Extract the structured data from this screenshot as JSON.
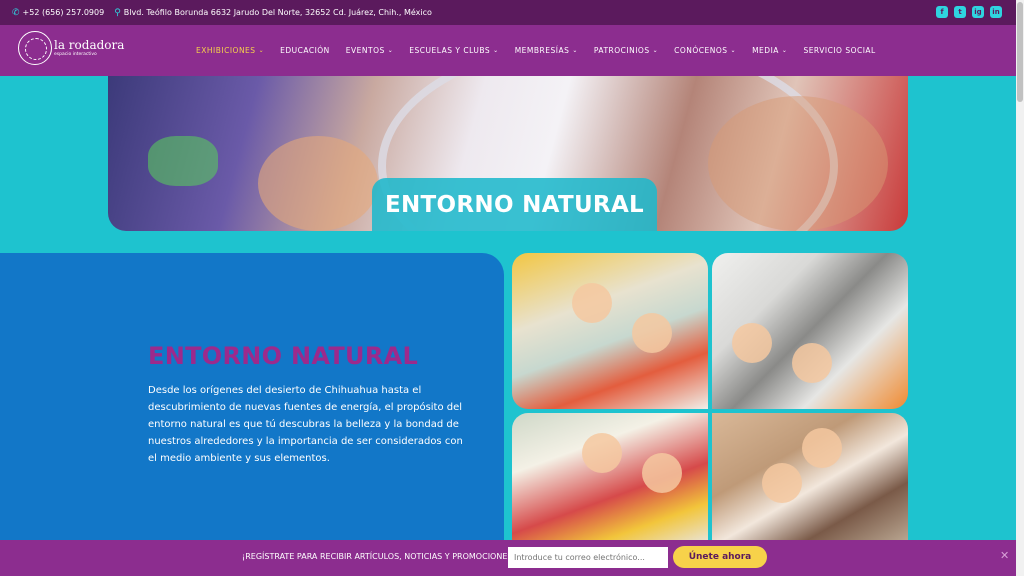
{
  "topbar": {
    "phone": "+52 (656) 257.0909",
    "address": "Blvd. Teófilo Borunda 6632 Jarudo Del Norte, 32652 Cd. Juárez, Chih., México",
    "social": [
      "f",
      "t",
      "ig",
      "in"
    ]
  },
  "logo": {
    "line1": "la rodadora",
    "line2": "espacio interactivo"
  },
  "nav": {
    "items": [
      {
        "label": "EXHIBICIONES",
        "dropdown": true
      },
      {
        "label": "EDUCACIÓN",
        "dropdown": false
      },
      {
        "label": "EVENTOS",
        "dropdown": true
      },
      {
        "label": "ESCUELAS Y CLUBS",
        "dropdown": true
      },
      {
        "label": "MEMBRESÍAS",
        "dropdown": true
      },
      {
        "label": "PATROCINIOS",
        "dropdown": true
      },
      {
        "label": "CONÓCENOS",
        "dropdown": true
      },
      {
        "label": "MEDIA",
        "dropdown": true
      },
      {
        "label": "SERVICIO SOCIAL",
        "dropdown": false
      }
    ],
    "active": "EXHIBICIONES"
  },
  "hero": {
    "title": "ENTORNO NATURAL"
  },
  "section": {
    "title": "ENTORNO NATURAL",
    "text": "Desde los orígenes del desierto de Chihuahua hasta el descubrimiento de nuevas fuentes de energía, el propósito del entorno natural es que tú descubras la belleza y la bondad de nuestros alrededores y la importancia de ser considerados con el medio ambiente y sus elementos."
  },
  "subscribe": {
    "text": "¡REGÍSTRATE PARA RECIBIR ARTÍCULOS, NOTICIAS Y PROMOCIONES!",
    "placeholder": "Introduce tu correo electrónico...",
    "button": "Únete ahora",
    "close": "✕"
  },
  "colors": {
    "topbar": "#5b1a5d",
    "nav": "#8c2d8f",
    "teal": "#1ec3cf",
    "blue": "#1277c8",
    "title": "#9c2a8c",
    "accent": "#f7d24a"
  }
}
